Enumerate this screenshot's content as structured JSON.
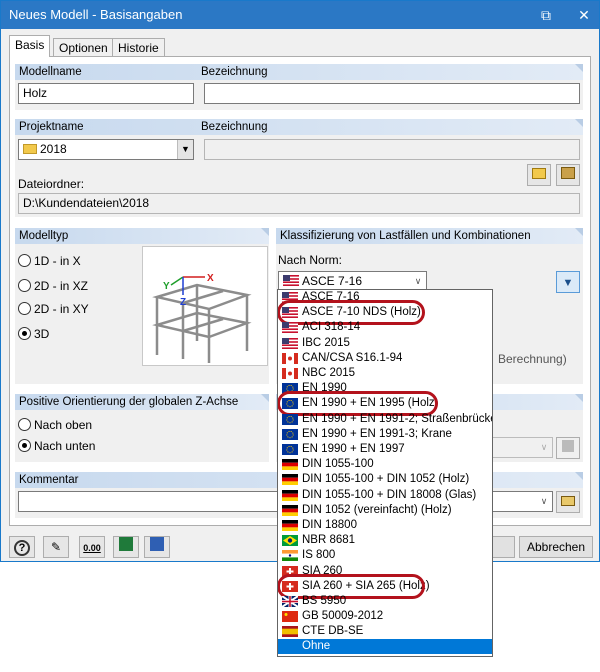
{
  "window": {
    "title": "Neues Modell - Basisangaben",
    "maximize_icon": "maximize-icon",
    "close_icon": "close-icon"
  },
  "tabs": [
    {
      "label": "Basis"
    },
    {
      "label": "Optionen"
    },
    {
      "label": "Historie"
    }
  ],
  "modell": {
    "name_header": "Modellname",
    "desc_header": "Bezeichnung",
    "name_value": "Holz",
    "desc_value": ""
  },
  "projekt": {
    "name_header": "Projektname",
    "desc_header": "Bezeichnung",
    "name_value": "2018",
    "desc_value": "",
    "folder_label": "Dateiordner:",
    "folder_value": "D:\\Kundendateien\\2018"
  },
  "modelltyp": {
    "header": "Modelltyp",
    "options": [
      {
        "label": "1D - in X",
        "selected": false
      },
      {
        "label": "2D - in XZ",
        "selected": false
      },
      {
        "label": "2D - in XY",
        "selected": false
      },
      {
        "label": "3D",
        "selected": true
      }
    ],
    "axis_labels": {
      "x": "X",
      "y": "Y",
      "z": "Z"
    }
  },
  "klassifizierung": {
    "header": "Klassifizierung von Lastfällen und Kombinationen",
    "norm_label": "Nach Norm:",
    "norm_value": "ASCE 7-16",
    "hidden_text": "Berechnung)"
  },
  "orientierung": {
    "header": "Positive Orientierung der globalen Z-Achse",
    "options": [
      {
        "label": "Nach oben",
        "selected": false
      },
      {
        "label": "Nach unten",
        "selected": true
      }
    ]
  },
  "kommentar": {
    "header": "Kommentar",
    "value": ""
  },
  "footer": {
    "cancel_label": "Abbrechen",
    "calc_icon_text": "0.00"
  },
  "norm_options": [
    {
      "label": "ASCE 7-16",
      "flag": "us"
    },
    {
      "label": "ASCE 7-10 NDS (Holz)",
      "flag": "us"
    },
    {
      "label": "ACI 318-14",
      "flag": "us"
    },
    {
      "label": "IBC 2015",
      "flag": "us"
    },
    {
      "label": "CAN/CSA S16.1-94",
      "flag": "ca"
    },
    {
      "label": "NBC 2015",
      "flag": "ca"
    },
    {
      "label": "EN 1990",
      "flag": "eu"
    },
    {
      "label": "EN 1990 + EN 1995 (Holz)",
      "flag": "eu"
    },
    {
      "label": "EN 1990 + EN 1991-2; Straßenbrücken",
      "flag": "eu"
    },
    {
      "label": "EN 1990 + EN 1991-3; Krane",
      "flag": "eu"
    },
    {
      "label": "EN 1990 + EN 1997",
      "flag": "eu"
    },
    {
      "label": "DIN 1055-100",
      "flag": "de"
    },
    {
      "label": "DIN 1055-100 + DIN 1052 (Holz)",
      "flag": "de"
    },
    {
      "label": "DIN 1055-100 + DIN 18008 (Glas)",
      "flag": "de"
    },
    {
      "label": "DIN 1052 (vereinfacht) (Holz)",
      "flag": "de"
    },
    {
      "label": "DIN 18800",
      "flag": "de"
    },
    {
      "label": "NBR 8681",
      "flag": "br"
    },
    {
      "label": "IS 800",
      "flag": "in"
    },
    {
      "label": "SIA 260",
      "flag": "ch"
    },
    {
      "label": "SIA 260 + SIA 265 (Holz)",
      "flag": "ch"
    },
    {
      "label": "BS 5950",
      "flag": "uk"
    },
    {
      "label": "GB 50009-2012",
      "flag": "cn"
    },
    {
      "label": "CTE DB-SE",
      "flag": "es"
    },
    {
      "label": "",
      "flag": ""
    },
    {
      "label": "Ohne",
      "flag": ""
    }
  ],
  "highlighted_options": [
    "ASCE 7-10 NDS (Holz)",
    "EN 1990 + EN 1995 (Holz)",
    "SIA 260 + SIA 265 (Holz)"
  ],
  "selected_option": "Ohne",
  "colors": {
    "titlebar": "#2b78c5",
    "group_header": "#c7d9ee",
    "highlight_ring": "#b3121c",
    "selection": "#0078d7"
  }
}
